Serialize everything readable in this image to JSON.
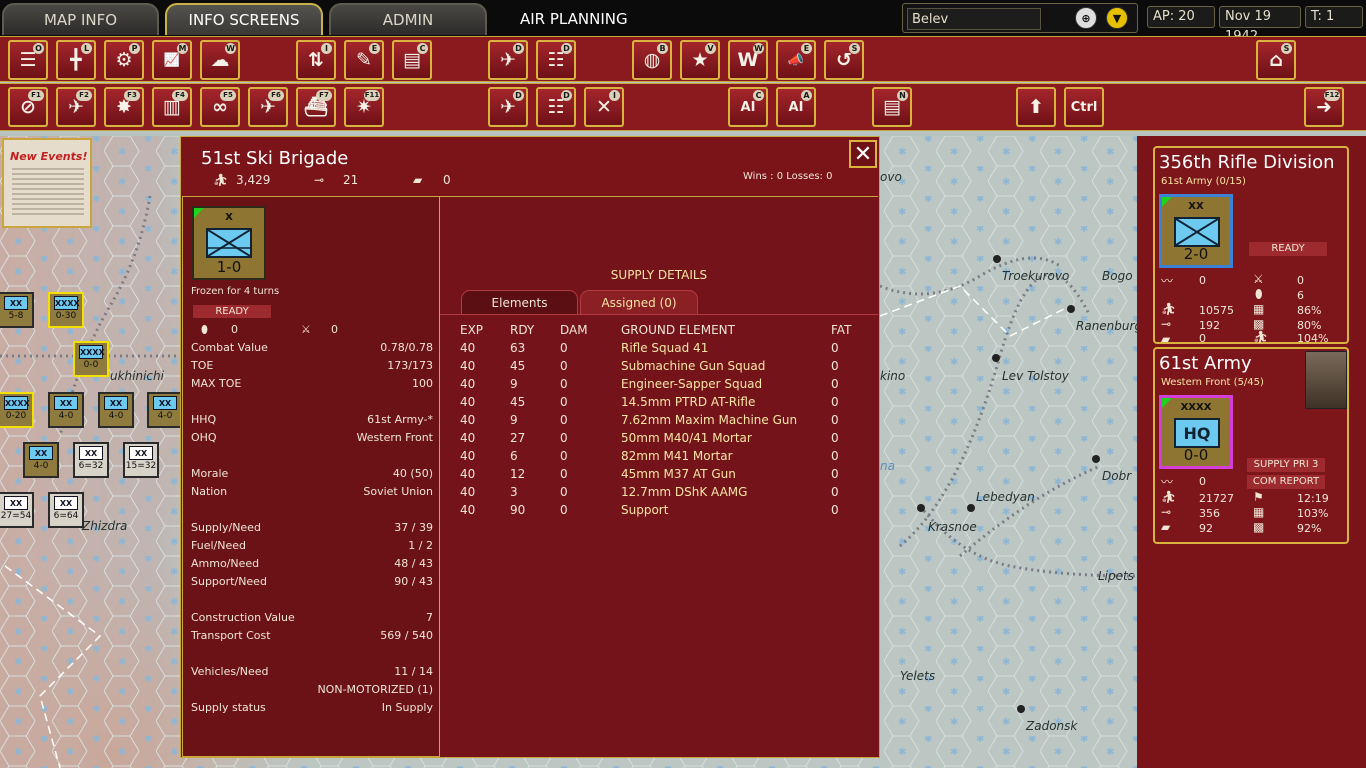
{
  "tabs": [
    "MAP INFO",
    "INFO SCREENS",
    "ADMIN"
  ],
  "air_planning": "AIR PLANNING",
  "search": {
    "value": "Belev"
  },
  "status": {
    "ap": "AP: 20",
    "date": "Nov 19 1942",
    "turn": "T: 1"
  },
  "toolbar1": [
    {
      "icon": "orders-list-icon",
      "key": "O"
    },
    {
      "icon": "unit-list-icon",
      "key": "L"
    },
    {
      "icon": "settings-gear-icon",
      "key": "P"
    },
    {
      "icon": "chart-icon",
      "key": "M"
    },
    {
      "icon": "weather-icon",
      "key": "W"
    },
    {
      "icon": "attrition-arrows-icon",
      "key": "I"
    },
    {
      "icon": "events-icon",
      "key": "E"
    },
    {
      "icon": "commanders-icon",
      "key": "C"
    },
    {
      "icon": "air-unit-icon",
      "key": "D"
    },
    {
      "icon": "air-group-list-icon",
      "key": "D"
    },
    {
      "icon": "world-report-icon",
      "key": "B"
    },
    {
      "icon": "victory-star-icon",
      "key": "V"
    },
    {
      "icon": "war-report-icon",
      "key": "W"
    },
    {
      "icon": "announce-icon",
      "key": "E"
    },
    {
      "icon": "replay-icon",
      "key": "S"
    },
    {
      "icon": "production-icon",
      "key": "S"
    }
  ],
  "toolbar2": [
    {
      "icon": "no-move-icon",
      "key": "F1"
    },
    {
      "icon": "air-ground-icon",
      "key": "F2"
    },
    {
      "icon": "air-bomb-icon",
      "key": "F3"
    },
    {
      "icon": "air-city-icon",
      "key": "F4"
    },
    {
      "icon": "air-recon-icon",
      "key": "F5"
    },
    {
      "icon": "air-transport-icon",
      "key": "F6"
    },
    {
      "icon": "air-naval-icon",
      "key": "F7"
    },
    {
      "icon": "ground-explosion-icon",
      "key": "F11"
    },
    {
      "icon": "air-unit-icon",
      "key": "D"
    },
    {
      "icon": "air-group-list-icon",
      "key": "D"
    },
    {
      "icon": "air-interdict-icon",
      "key": "I"
    },
    {
      "icon": "ai-production-icon",
      "key": "C"
    },
    {
      "icon": "ai-air-icon",
      "key": "A"
    },
    {
      "icon": "air-base-icon",
      "key": "N"
    },
    {
      "icon": "move-up-icon",
      "key": ""
    },
    {
      "icon": "ctrl-key-icon",
      "key": ""
    },
    {
      "icon": "next-arrow-icon",
      "key": "F12"
    }
  ],
  "map": {
    "news_title": "New Events!",
    "cities": [
      "ovo",
      "Troekurovo",
      "Bogo",
      "Ranenburg",
      "kino",
      "Lev Tolstoy",
      "Dobr",
      "Lebedyan",
      "Krasnoe",
      "Lipets",
      "Yelets",
      "Zadonsk",
      "ukhinichi",
      "Zhizdra",
      "na"
    ],
    "units": [
      {
        "top": "XX",
        "val": "5-8"
      },
      {
        "top": "XXXX",
        "val": "0-30"
      },
      {
        "top": "XXXX",
        "val": "0-0"
      },
      {
        "top": "XXXX",
        "val": "0-20"
      },
      {
        "top": "XX",
        "val": "4-0"
      },
      {
        "top": "XX",
        "val": "4-0"
      },
      {
        "top": "XX",
        "val": "4-0"
      },
      {
        "top": "XX",
        "val": "4-0"
      },
      {
        "top": "XX",
        "val": "6=32"
      },
      {
        "top": "XX",
        "val": "15=32"
      },
      {
        "top": "XX",
        "val": "27=54"
      },
      {
        "top": "XX",
        "val": "6=64"
      }
    ]
  },
  "panel": {
    "title": "51st Ski Brigade",
    "men": "3,429",
    "guns": "21",
    "tanks": "0",
    "wins_losses": "Wins : 0  Losses: 0",
    "counter": {
      "size": "X",
      "value": "1-0"
    },
    "frozen": "Frozen for 4 turns",
    "ready": "READY",
    "fort_a": "0",
    "fort_b": "0",
    "stats": [
      {
        "label": "Combat Value",
        "value": "0.78/0.78"
      },
      {
        "label": "TOE",
        "value": "173/173"
      },
      {
        "label": "MAX TOE",
        "value": "100"
      },
      {
        "label": "HHQ",
        "value": "61st Army-*"
      },
      {
        "label": "OHQ",
        "value": "Western Front"
      },
      {
        "label": "Morale",
        "value": "40 (50)"
      },
      {
        "label": "Nation",
        "value": "Soviet Union"
      },
      {
        "label": "Supply/Need",
        "value": "37 / 39"
      },
      {
        "label": "Fuel/Need",
        "value": "1 / 2"
      },
      {
        "label": "Ammo/Need",
        "value": "48 / 43"
      },
      {
        "label": "Support/Need",
        "value": "90 / 43"
      },
      {
        "label": "Construction Value",
        "value": "7"
      },
      {
        "label": "Transport Cost",
        "value": "569 / 540"
      },
      {
        "label": "Vehicles/Need",
        "value": "11 / 14"
      },
      {
        "label": "",
        "value": "NON-MOTORIZED (1)"
      },
      {
        "label": "Supply status",
        "value": "In Supply"
      }
    ],
    "supply_details": "SUPPLY DETAILS",
    "subtabs": [
      "Elements",
      "Assigned (0)"
    ],
    "headers": [
      "EXP",
      "RDY",
      "DAM",
      "GROUND ELEMENT",
      "FAT"
    ],
    "elements": [
      {
        "exp": "40",
        "rdy": "63",
        "dam": "0",
        "name": "Rifle Squad 41",
        "fat": "0"
      },
      {
        "exp": "40",
        "rdy": "45",
        "dam": "0",
        "name": "Submachine Gun Squad",
        "fat": "0"
      },
      {
        "exp": "40",
        "rdy": "9",
        "dam": "0",
        "name": "Engineer-Sapper Squad",
        "fat": "0"
      },
      {
        "exp": "40",
        "rdy": "45",
        "dam": "0",
        "name": "14.5mm PTRD AT-Rifle",
        "fat": "0"
      },
      {
        "exp": "40",
        "rdy": "9",
        "dam": "0",
        "name": "7.62mm Maxim Machine Gun",
        "fat": "0"
      },
      {
        "exp": "40",
        "rdy": "27",
        "dam": "0",
        "name": "50mm M40/41 Mortar",
        "fat": "0"
      },
      {
        "exp": "40",
        "rdy": "6",
        "dam": "0",
        "name": "82mm M41 Mortar",
        "fat": "0"
      },
      {
        "exp": "40",
        "rdy": "12",
        "dam": "0",
        "name": "45mm M37 AT Gun",
        "fat": "0"
      },
      {
        "exp": "40",
        "rdy": "3",
        "dam": "0",
        "name": "12.7mm DShK AAMG",
        "fat": "0"
      },
      {
        "exp": "40",
        "rdy": "90",
        "dam": "0",
        "name": "Support",
        "fat": "0"
      }
    ]
  },
  "card1": {
    "title": "356th Rifle Division",
    "subtitle": "61st Army (0/15)",
    "counter_size": "XX",
    "counter_value": "2-0",
    "ready": "READY",
    "rows": [
      {
        "l": "0",
        "r": "0"
      },
      {
        "l": "",
        "r": "6"
      },
      {
        "l": "10575",
        "r": "86%"
      },
      {
        "l": "192",
        "r": "80%"
      },
      {
        "l": "0",
        "r": "104%"
      }
    ]
  },
  "card2": {
    "title": "61st Army",
    "subtitle": "Western Front (5/45)",
    "counter_size": "XXXX",
    "counter_value": "0-0",
    "counter_label": "HQ",
    "supply_pri": "SUPPLY PRI 3",
    "com_report": "COM REPORT",
    "rows": [
      {
        "l": "0",
        "r": ""
      },
      {
        "l": "21727",
        "r": "12:19"
      },
      {
        "l": "356",
        "r": "103%"
      },
      {
        "l": "92",
        "r": "92%"
      }
    ]
  },
  "colors": {
    "panel": "#7a1418",
    "gold": "#c9a63b",
    "element_text": "#f6e5a6",
    "allied_blue": "#6ccaf0"
  }
}
